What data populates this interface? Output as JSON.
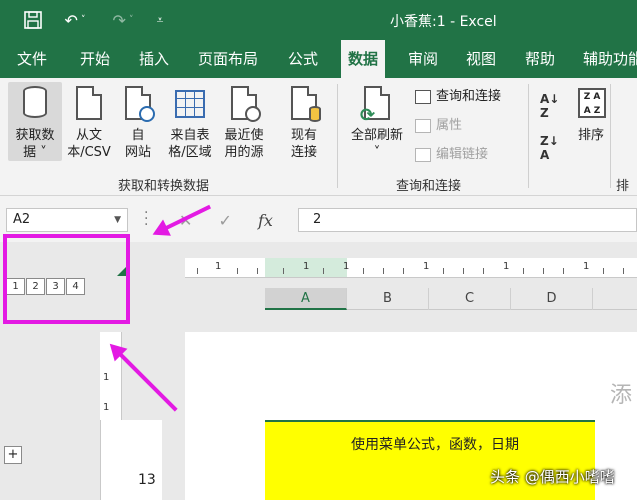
{
  "window": {
    "title": "小香蕉:1  -  Excel"
  },
  "quick_access": [
    "save-icon",
    "undo-icon",
    "redo-icon",
    "customize-icon"
  ],
  "tabs": [
    {
      "label": "文件"
    },
    {
      "label": "开始"
    },
    {
      "label": "插入"
    },
    {
      "label": "页面布局"
    },
    {
      "label": "公式"
    },
    {
      "label": "数据"
    },
    {
      "label": "审阅"
    },
    {
      "label": "视图"
    },
    {
      "label": "帮助"
    },
    {
      "label": "辅助功能"
    }
  ],
  "active_tab": "数据",
  "ribbon": {
    "get_data": {
      "line1": "获取数",
      "line2": "据 ˅"
    },
    "from_csv": {
      "line1": "从文",
      "line2": "本/CSV"
    },
    "from_web": {
      "line1": "自",
      "line2": "网站"
    },
    "from_table": {
      "line1": "来自表",
      "line2": "格/区域"
    },
    "recent_sources": {
      "line1": "最近使",
      "line2": "用的源"
    },
    "existing_connections": {
      "line1": "现有",
      "line2": "连接"
    },
    "refresh_all": {
      "line1": "全部刷新",
      "line2": "˅"
    },
    "queries_connections": "查询和连接",
    "properties": "属性",
    "edit_links": "编辑链接",
    "sort": "排序",
    "group_get_transform": "获取和转换数据",
    "group_queries": "查询和连接",
    "group_sort_partial": "排"
  },
  "formula_bar": {
    "name_box": "A2",
    "formula": "2",
    "fx": "fx"
  },
  "outline_levels": [
    "1",
    "2",
    "3",
    "4"
  ],
  "ruler": {
    "numbers": [
      "1",
      "1",
      "1",
      "1",
      "1",
      "1"
    ]
  },
  "columns": [
    "A",
    "B",
    "C",
    "D"
  ],
  "selected_column": "A",
  "vertical_ruler": [
    "1",
    "1"
  ],
  "page": {
    "header_text": "添",
    "cell_text": "使用菜单公式，函数，日期"
  },
  "row_number": "13",
  "plus": "+",
  "watermark": "头条 @偶西小嗜嗜"
}
